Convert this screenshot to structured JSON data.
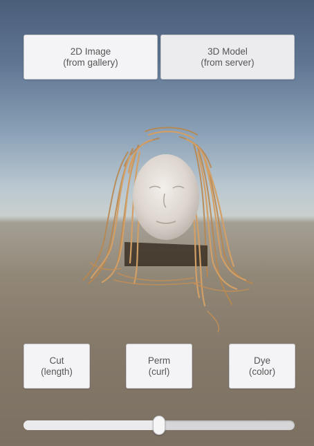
{
  "top_buttons": {
    "image_2d": {
      "line1": "2D Image",
      "line2": "(from gallery)"
    },
    "model_3d": {
      "line1": "3D Model",
      "line2": "(from server)"
    }
  },
  "style_buttons": {
    "cut": {
      "line1": "Cut",
      "line2": "(length)"
    },
    "perm": {
      "line1": "Perm",
      "line2": "(curl)"
    },
    "dye": {
      "line1": "Dye",
      "line2": "(color)"
    }
  },
  "slider": {
    "value_fraction": 0.5
  },
  "colors": {
    "hair": "#c9965e",
    "face": "#e8e2dc",
    "button_bg": "#f4f4f6",
    "button_text": "#555555"
  }
}
